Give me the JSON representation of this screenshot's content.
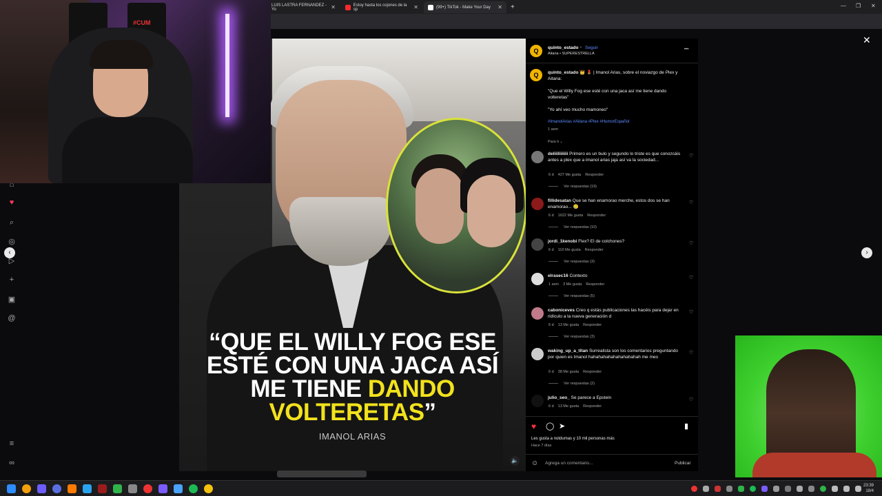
{
  "browser": {
    "tabs": [
      {
        "label": "LUIS LASTRA FERNANDEZ - Yo"
      },
      {
        "label": "Estoy hasta los cojones de la sp"
      },
      {
        "label": "(99+) TikTok - Make Your Day"
      }
    ]
  },
  "post": {
    "quote_part1": "“QUE EL WILLY FOG ESE ESTÉ CON UNA JACA ASÍ ME TIENE ",
    "quote_highlight": "DANDO VOLTERETAS",
    "quote_end": "”",
    "author": "IMANOL ARIAS"
  },
  "panel": {
    "header": {
      "username": "quinto_estado",
      "follow": "Seguir",
      "dot": "•",
      "audio": "Aitana • SUPERESTRELLA",
      "more": "•••"
    },
    "caption": {
      "username": "quinto_estado",
      "intro": "👑 💄 | Imanol Arias, sobre el noviazgo de Plex y Aitana:",
      "line1": "\"Que el Willy Fog ese esté con una jaca así me tiene dando volteretas\"",
      "line2": "\"Yo ahí veo mucho mamoneo\"",
      "hashtags": "#ImanolArias #Aitana #Plex #HumorEspañol",
      "time": "1 sem",
      "for_you": "Para ti ⌄"
    },
    "comments": [
      {
        "user": "deliiiliiiiiii",
        "text": "Primero es un bulo y segundo lo triste es que conozcáis antes a plex que a imanol arias jaja así va la sociedad...",
        "meta": "6 d    427 Me gusta    Responder",
        "replies": "Ver respuestas (19)"
      },
      {
        "user": "fillidesatan",
        "text": "Que se han enamorao merche, estos dos se han enamorao... 🥲",
        "meta": "6 d    1622 Me gusta    Responder",
        "replies": "Ver respuestas (10)"
      },
      {
        "user": "jordi_1kenobi",
        "text": "Flex? El de colchones?",
        "meta": "6 d    110 Me gusta    Responder",
        "replies": "Ver respuestas (3)"
      },
      {
        "user": "elrasec16",
        "text": "Contexto",
        "meta": "1 sem    3 Me gusta    Responder",
        "replies": "Ver respuestas (5)"
      },
      {
        "user": "caboniceves",
        "text": "Creo q estás publicaciones las hacéis para dejar en ridículo a la nueva generación d",
        "meta": "6 d    13 Me gusta    Responder",
        "replies": "Ver respuestas (3)"
      },
      {
        "user": "waking_up_a_titan",
        "text": "Surrealista son los comentarios preguntando por quien es Imanol hahahahahahahahahahah me meo",
        "meta": "6 d    38 Me gusta    Responder",
        "replies": "Ver respuestas (2)"
      },
      {
        "user": "julio_seo_",
        "text": "Se parece a Epstein",
        "meta": "6 d    13 Me gusta    Responder",
        "replies": ""
      }
    ],
    "likes": "Les gusta a notdumas y 10 mil personas más",
    "date": "Hace 7 días",
    "comment_placeholder": "Agrega un comentario...",
    "publish": "Publicar"
  },
  "taskbar": {
    "time": "23:39",
    "date": "18/4"
  },
  "colors": {
    "accent_yellow": "#f2e21c",
    "link_blue": "#5b8cff",
    "like_red": "#ff3040"
  }
}
